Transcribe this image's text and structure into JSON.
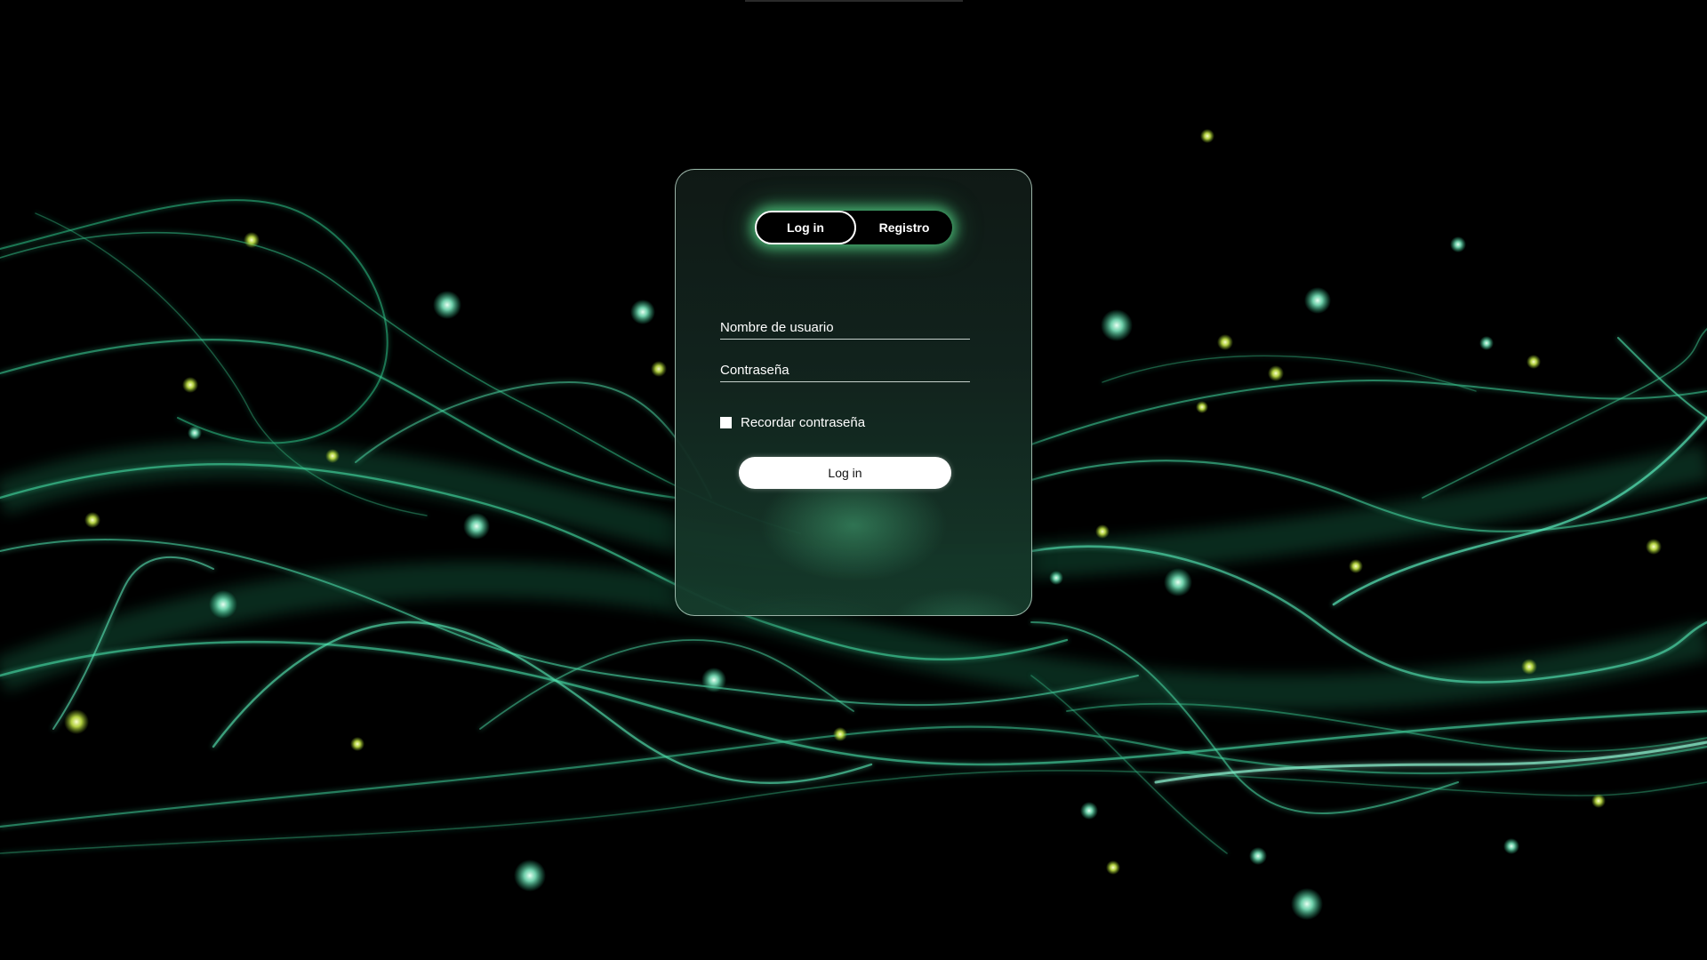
{
  "tabs": {
    "login_label": "Log in",
    "register_label": "Registro"
  },
  "form": {
    "username_placeholder": "Nombre de usuario",
    "password_placeholder": "Contraseña",
    "remember_label": "Recordar contraseña",
    "submit_label": "Log in"
  },
  "colors": {
    "background": "#000000",
    "accent_green": "#3fd98a",
    "glow_green": "#5adc8c",
    "card_border": "#c8e6d7",
    "text": "#ffffff"
  }
}
